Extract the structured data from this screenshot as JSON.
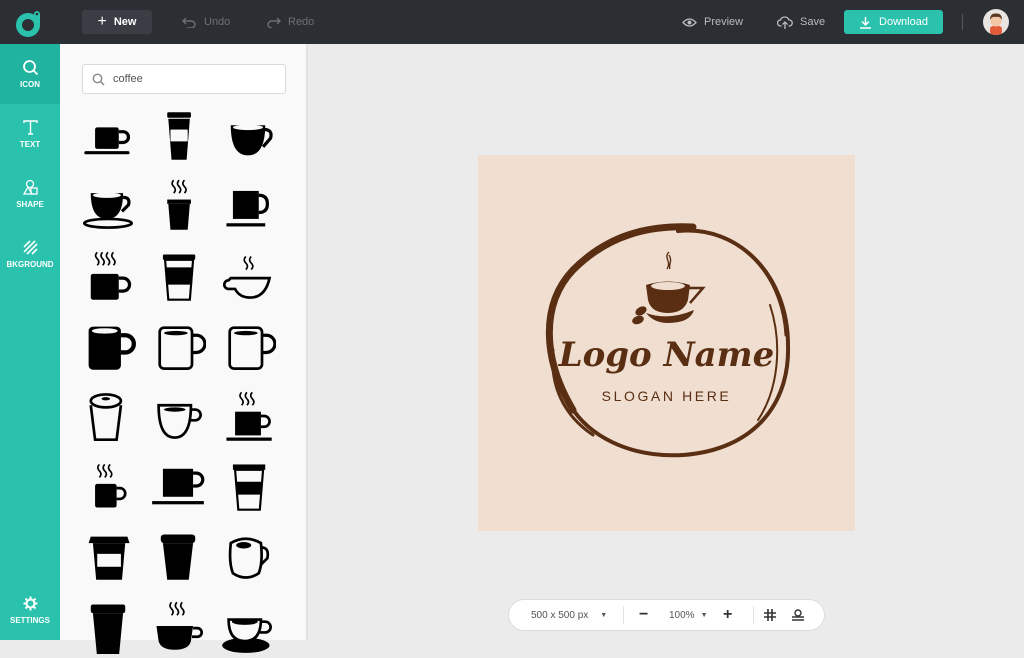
{
  "topbar": {
    "new_label": "New",
    "undo_label": "Undo",
    "redo_label": "Redo",
    "preview_label": "Preview",
    "save_label": "Save",
    "download_label": "Download",
    "accent_color": "#2ac1ad"
  },
  "nav": {
    "items": [
      {
        "label": "ICON",
        "icon": "search-icon",
        "active": true
      },
      {
        "label": "TEXT",
        "icon": "text-icon",
        "active": false
      },
      {
        "label": "SHAPE",
        "icon": "shape-icon",
        "active": false
      },
      {
        "label": "BKGROUND",
        "icon": "background-icon",
        "active": false
      }
    ],
    "settings_label": "SETTINGS"
  },
  "panel": {
    "search_value": "coffee",
    "icons": [
      "cup-on-saucer",
      "takeaway-cup-sleeve",
      "round-cup",
      "teacup-saucer",
      "steaming-takeaway-cup",
      "square-mug-plate",
      "steaming-mug",
      "takeaway-cup-band",
      "steaming-bowl-cup",
      "solid-mug",
      "outline-mug",
      "outline-mug-2",
      "lidded-cup",
      "outline-cup",
      "steaming-mug-plate",
      "small-steaming-mug",
      "flat-mug-plate",
      "takeaway-cup-stripe",
      "takeaway-cup-window",
      "solid-tumbler",
      "outline-round-mug",
      "tall-tumbler",
      "steaming-wide-cup",
      "espresso-saucer"
    ]
  },
  "canvas": {
    "logo_name": "Logo Name",
    "slogan": "SLOGAN HERE",
    "background_color": "#f0dfd0",
    "brand_color": "#5a2e12"
  },
  "bottombar": {
    "size_label": "500 x 500 px",
    "zoom_label": "100%"
  }
}
